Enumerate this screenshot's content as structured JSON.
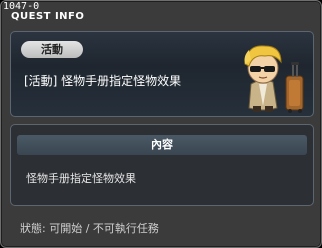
{
  "window": {
    "quest_id": "1047-0",
    "title": "QUEST INFO"
  },
  "quest": {
    "category": "活動",
    "name": "[活動] 怪物手册指定怪物效果"
  },
  "content": {
    "header": "內容",
    "text": "怪物手册指定怪物效果"
  },
  "status": {
    "text": "狀態: 可開始 / 不可執行任務"
  },
  "npc": {
    "icon": "npc-traveler-sunglasses-suitcase"
  },
  "colors": {
    "window_bg": "#3b3b3b",
    "panel_bg": "#1f262f",
    "pill_bg": "#d0d0d0",
    "header_bg": "#44525e",
    "text": "#ffffff"
  }
}
